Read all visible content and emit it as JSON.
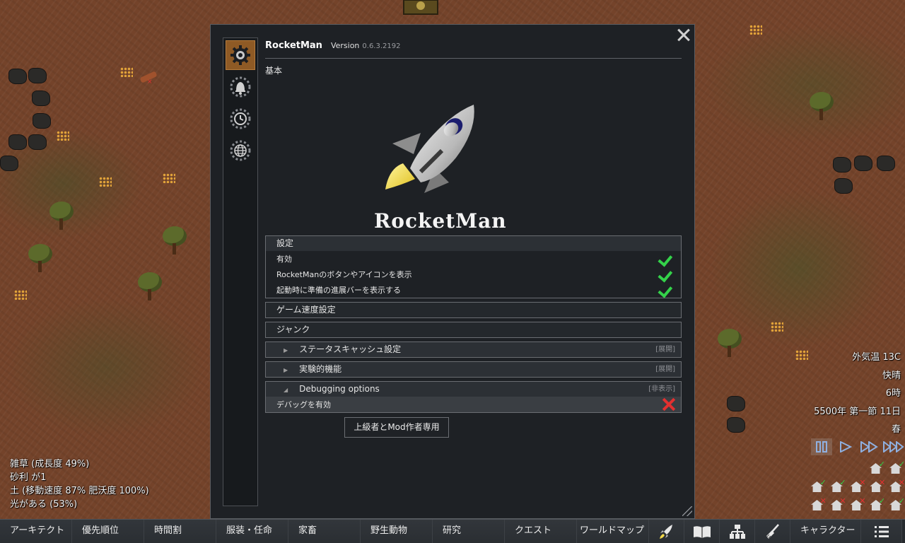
{
  "dialog": {
    "mod_name": "RocketMan",
    "version_label": "Version",
    "version_number": "0.6.3.2192",
    "section_title": "基本",
    "logo_text": "RocketMan",
    "side_tabs": [
      {
        "icon": "gear-icon",
        "active": true
      },
      {
        "icon": "bell-icon",
        "active": false
      },
      {
        "icon": "clock-icon",
        "active": false
      },
      {
        "icon": "globe-icon",
        "active": false
      }
    ],
    "settings_group": {
      "title": "設定",
      "options": [
        {
          "label": "有効",
          "checked": true
        },
        {
          "label": "RocketManのボタンやアイコンを表示",
          "checked": true
        },
        {
          "label": "起動時に準備の進展バーを表示する",
          "checked": true
        }
      ]
    },
    "game_speed_title": "ゲーム速度設定",
    "junk_title": "ジャンク",
    "status_cache": {
      "title": "ステータスキャッシュ設定",
      "hint": "[展開]"
    },
    "experimental": {
      "title": "実験的機能",
      "hint": "[展開]"
    },
    "debugging": {
      "title": "Debugging options",
      "hint": "[非表示]",
      "option_label": "デバッグを有効",
      "enabled": false
    },
    "tooltip": "上級者とMod作者専用"
  },
  "cell_info": [
    "雑草 (成長度 49%)",
    "砂利 が1",
    "土 (移動速度 87% 肥沃度 100%)",
    "光がある (53%)"
  ],
  "weather": [
    "外気温 13C",
    "快晴",
    "6時",
    "5500年 第一節 11日",
    "春"
  ],
  "bottom_bar": {
    "architect": "アーキテクト",
    "priorities": "優先順位",
    "schedule": "時間割",
    "assign": "服装・任命",
    "animals": "家畜",
    "wildlife": "野生動物",
    "research": "研究",
    "quests": "クエスト",
    "world": "ワールドマップ",
    "characters": "キャラクター"
  },
  "colors": {
    "check_green": "#34d24a",
    "cross_red": "#e23030",
    "active_tab": "#8e5a25",
    "panel_bg": "#1e2125"
  }
}
